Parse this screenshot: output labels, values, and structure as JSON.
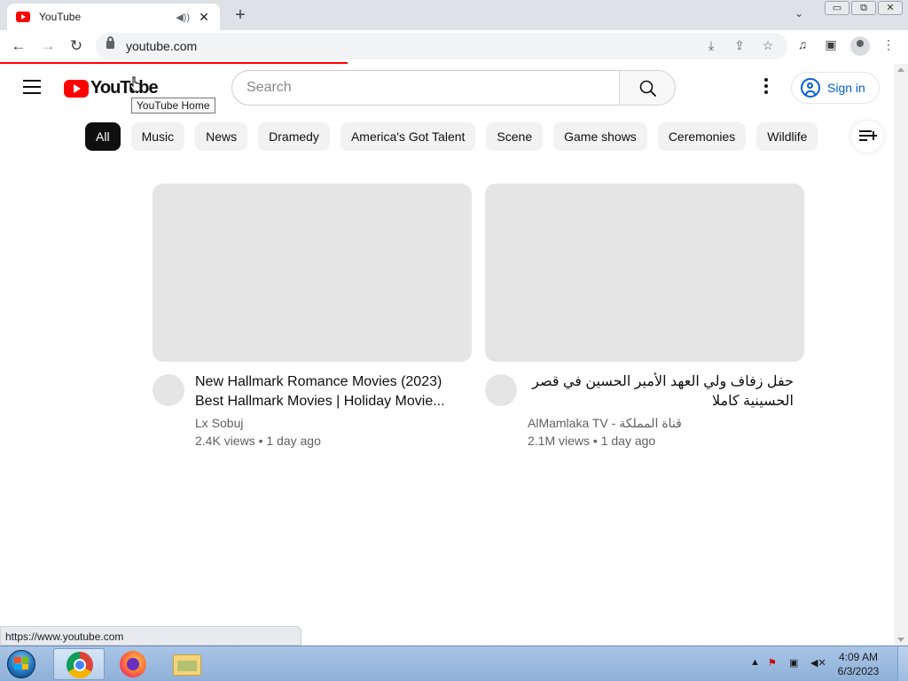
{
  "browser": {
    "tab": {
      "title": "YouTube",
      "audio_icon": "speaker-icon",
      "close_glyph": "✕"
    },
    "new_tab_glyph": "+",
    "tab_search_glyph": "⌄",
    "window_controls": {
      "minimize": "▭",
      "restore": "⧉",
      "close": "✕"
    },
    "nav": {
      "back": "←",
      "forward": "→",
      "reload": "↻"
    },
    "url": "youtube.com",
    "status_url": "https://www.youtube.com"
  },
  "youtube": {
    "logo_text": "YouTube",
    "tooltip": "YouTube Home",
    "search": {
      "placeholder": "Search"
    },
    "signin_label": "Sign in",
    "chips": [
      "All",
      "Music",
      "News",
      "Dramedy",
      "America's Got Talent",
      "Scene",
      "Game shows",
      "Ceremonies",
      "Wildlife"
    ],
    "active_chip": "All",
    "videos": [
      {
        "title": "New Hallmark Romance Movies (2023) Best Hallmark Movies | Holiday Movie...",
        "channel": "Lx Sobuj",
        "stats": "2.4K views • 1 day ago"
      },
      {
        "title": "حفل زفاف ولي العهد الأمير الحسين في قصر الحسينية كاملا",
        "channel": "AlMamlaka TV - قناة المملكة",
        "stats": "2.1M views • 1 day ago"
      }
    ]
  },
  "taskbar": {
    "clock_time": "4:09 AM",
    "clock_date": "6/3/2023",
    "apps": [
      "chrome-icon",
      "firefox-icon",
      "file-explorer-icon"
    ]
  },
  "colors": {
    "yt_red": "#ff0000",
    "link_blue": "#065fd4",
    "chip_bg": "#f2f2f2",
    "chip_active_bg": "#0f0f0f",
    "placeholder_gray": "#e5e5e5"
  }
}
